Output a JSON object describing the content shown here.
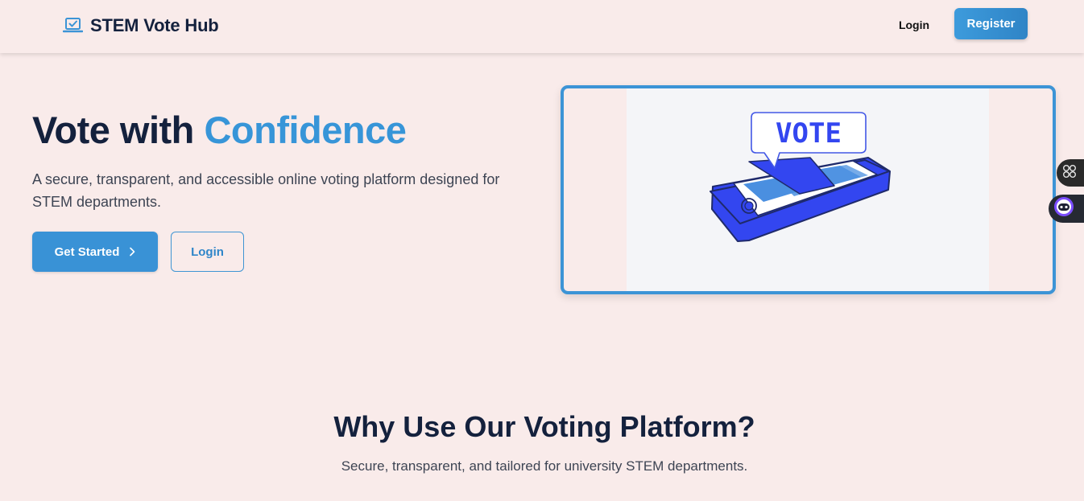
{
  "header": {
    "brand": "STEM Vote Hub",
    "login_label": "Login",
    "register_label": "Register"
  },
  "hero": {
    "title_prefix": "Vote with ",
    "title_accent": "Confidence",
    "subtitle": "A secure, transparent, and accessible online voting platform designed for STEM departments.",
    "get_started_label": "Get Started",
    "login_label": "Login"
  },
  "illustration": {
    "bubble_text": "VOTE"
  },
  "features": {
    "title": "Why Use Our Voting Platform?",
    "subtitle": "Secure, transparent, and tailored for university STEM departments."
  },
  "icons": {
    "brand": "laptop-check-icon",
    "get_started": "chevron-right-icon",
    "side_grid": "grid-icon",
    "side_assistant": "assistant-icon"
  },
  "colors": {
    "page_bg": "#f9ebea",
    "navy": "#14213d",
    "accent": "#3795d8",
    "illustration_blue": "#3346f0"
  }
}
